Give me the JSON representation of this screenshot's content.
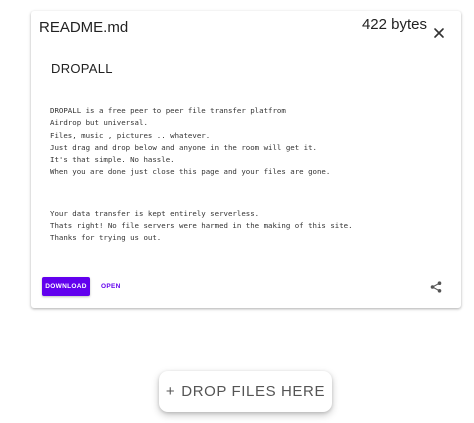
{
  "file_card": {
    "file_name": "README.md",
    "file_size": "422 bytes",
    "close_icon": "close-icon",
    "document": {
      "title": "DROPALL",
      "paragraph1": [
        "DROPALL is a free peer to peer file transfer platfrom",
        "Airdrop but universal.",
        "Files, music , pictures .. whatever.",
        "Just drag and drop below and anyone in the room will get it.",
        "It's that simple. No hassle.",
        "When you are done just close this page and your files are gone."
      ],
      "paragraph2": [
        "Your data transfer is kept entirely serverless.",
        "Thats right! No file servers were harmed in the making of this site.",
        "Thanks for trying us out."
      ]
    },
    "actions": {
      "download_label": "DOWNLOAD",
      "open_label": "OPEN",
      "share_icon": "share-icon"
    }
  },
  "drop_zone": {
    "plus": "+",
    "label": "DROP FILES HERE"
  },
  "colors": {
    "accent": "#6200ee",
    "text": "#222222"
  }
}
